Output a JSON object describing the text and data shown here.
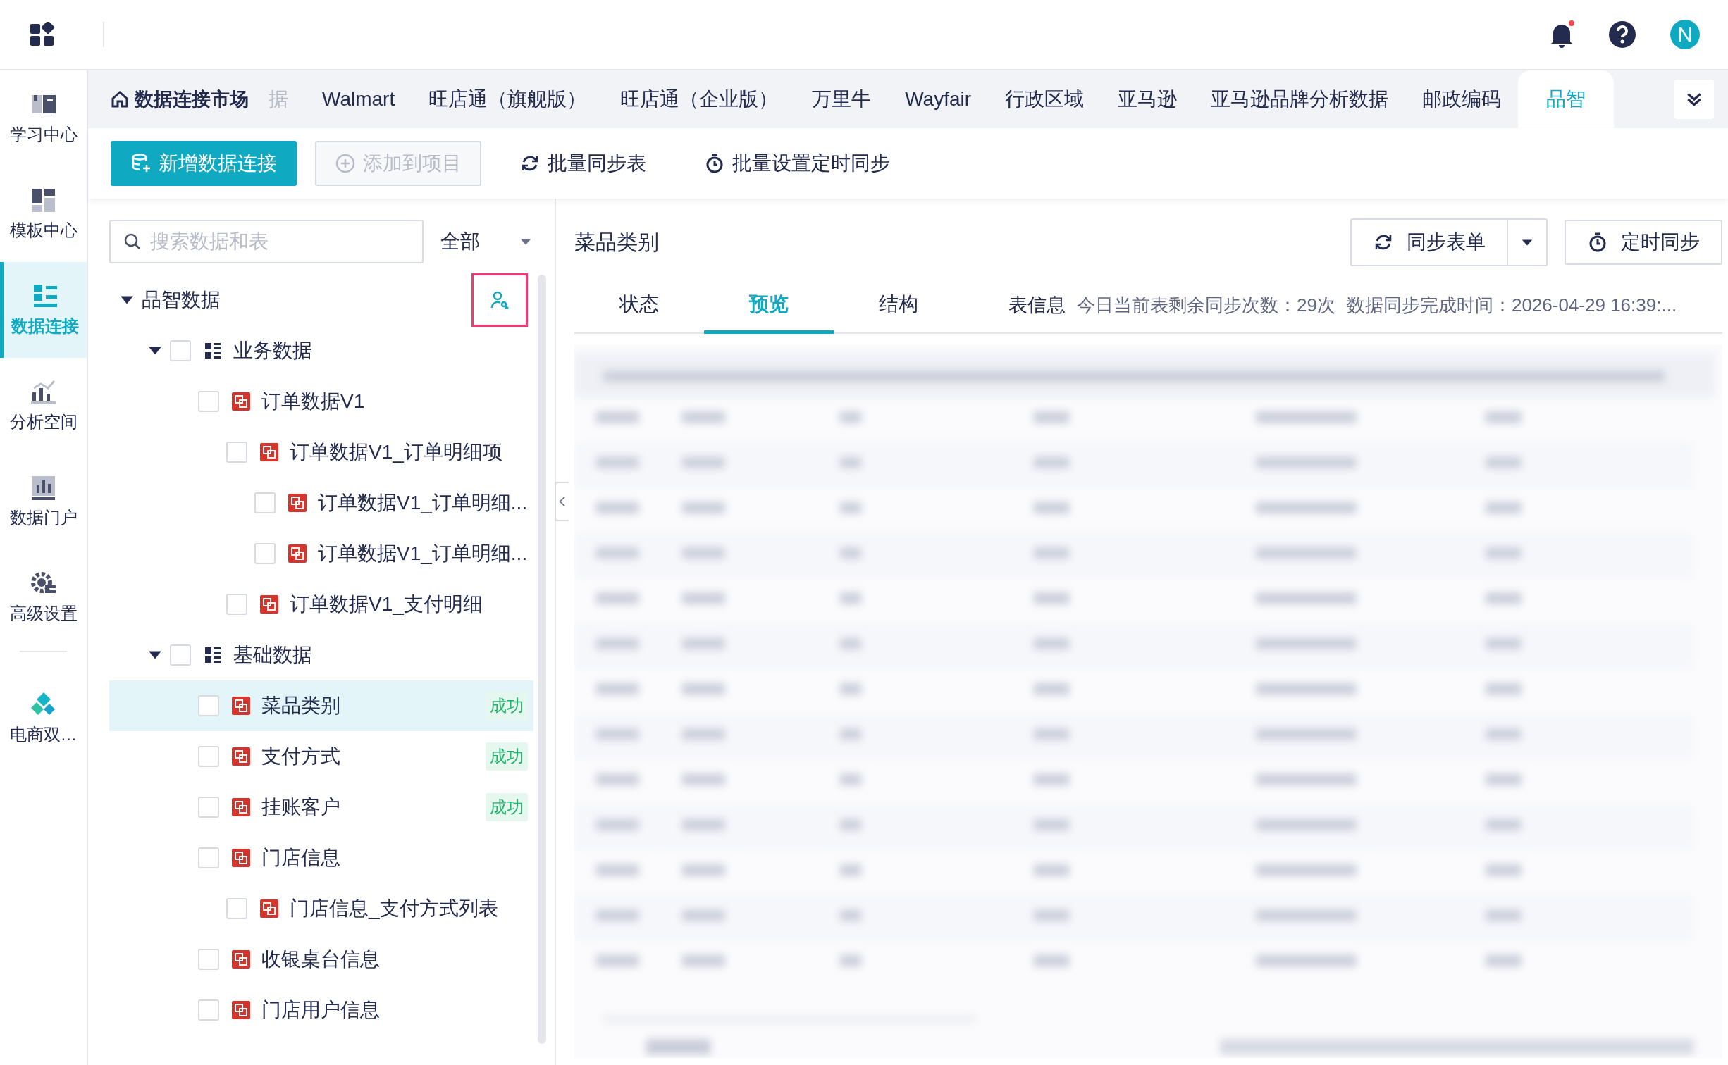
{
  "header": {
    "avatar": "N",
    "notification": true
  },
  "sidebar": {
    "items": [
      {
        "label": "学习中心",
        "kind": "book",
        "selected": false
      },
      {
        "label": "模板中心",
        "kind": "template",
        "selected": false
      },
      {
        "label": "数据连接",
        "kind": "connect",
        "selected": true
      },
      {
        "label": "分析空间",
        "kind": "analysis",
        "selected": false
      },
      {
        "label": "数据门户",
        "kind": "portal",
        "selected": false
      },
      {
        "label": "高级设置",
        "kind": "settings",
        "selected": false
      },
      {
        "label": "电商双…",
        "kind": "ecommerce",
        "selected": false,
        "divider_before": true
      }
    ]
  },
  "market_link": "数据连接市场",
  "tabs": [
    {
      "label": "据",
      "faded": true,
      "selected": false
    },
    {
      "label": "Walmart",
      "faded": false,
      "selected": false
    },
    {
      "label": "旺店通（旗舰版）",
      "faded": false,
      "selected": false
    },
    {
      "label": "旺店通（企业版）",
      "faded": false,
      "selected": false
    },
    {
      "label": "万里牛",
      "faded": false,
      "selected": false
    },
    {
      "label": "Wayfair",
      "faded": false,
      "selected": false
    },
    {
      "label": "行政区域",
      "faded": false,
      "selected": false
    },
    {
      "label": "亚马逊",
      "faded": false,
      "selected": false
    },
    {
      "label": "亚马逊品牌分析数据",
      "faded": false,
      "selected": false
    },
    {
      "label": "邮政编码",
      "faded": false,
      "selected": false
    },
    {
      "label": "品智",
      "faded": false,
      "selected": true
    }
  ],
  "toolbar": [
    {
      "label": "新增数据连接",
      "kind": "primary",
      "disabled": false
    },
    {
      "label": "添加到项目",
      "kind": "outline",
      "disabled": true
    },
    {
      "label": "批量同步表",
      "kind": "text",
      "disabled": false
    },
    {
      "label": "批量设置定时同步",
      "kind": "text",
      "disabled": false
    }
  ],
  "search": {
    "placeholder": "搜索数据和表"
  },
  "filter": {
    "value": "全部"
  },
  "tree": {
    "label": "品智数据",
    "expanded": true,
    "action_highlighted": true,
    "children": [
      {
        "label": "业务数据",
        "kind": "folder",
        "expanded": true,
        "checked": false,
        "children": [
          {
            "label": "订单数据V1",
            "kind": "table",
            "checked": false,
            "selected": false,
            "children": [
              {
                "label": "订单数据V1_订单明细项",
                "kind": "table",
                "checked": false,
                "selected": false,
                "children": [
                  {
                    "label": "订单数据V1_订单明细...",
                    "kind": "table",
                    "checked": false,
                    "selected": false
                  },
                  {
                    "label": "订单数据V1_订单明细...",
                    "kind": "table",
                    "checked": false,
                    "selected": false
                  }
                ]
              },
              {
                "label": "订单数据V1_支付明细",
                "kind": "table",
                "checked": false,
                "selected": false
              }
            ]
          }
        ]
      },
      {
        "label": "基础数据",
        "kind": "folder",
        "expanded": true,
        "checked": false,
        "children": [
          {
            "label": "菜品类别",
            "kind": "table",
            "checked": false,
            "selected": true,
            "status": "成功"
          },
          {
            "label": "支付方式",
            "kind": "table",
            "checked": false,
            "selected": false,
            "status": "成功"
          },
          {
            "label": "挂账客户",
            "kind": "table",
            "checked": false,
            "selected": false,
            "status": "成功"
          },
          {
            "label": "门店信息",
            "kind": "table",
            "checked": false,
            "selected": false,
            "children": [
              {
                "label": "门店信息_支付方式列表",
                "kind": "table",
                "checked": false,
                "selected": false
              }
            ]
          },
          {
            "label": "收银桌台信息",
            "kind": "table",
            "checked": false,
            "selected": false
          },
          {
            "label": "门店用户信息",
            "kind": "table",
            "checked": false,
            "selected": false
          }
        ]
      }
    ]
  },
  "detail": {
    "title": "菜品类别",
    "sync_button": "同步表单",
    "schedule_button": "定时同步",
    "tabs": [
      {
        "label": "状态",
        "selected": false
      },
      {
        "label": "预览",
        "selected": true
      },
      {
        "label": "结构",
        "selected": false
      }
    ],
    "info_label": "表信息",
    "info": [
      "今日当前表剩余同步次数：29次",
      "数据同步完成时间：2026-04-29 16:39:..."
    ],
    "preview": {
      "kind": "picture"
    }
  }
}
